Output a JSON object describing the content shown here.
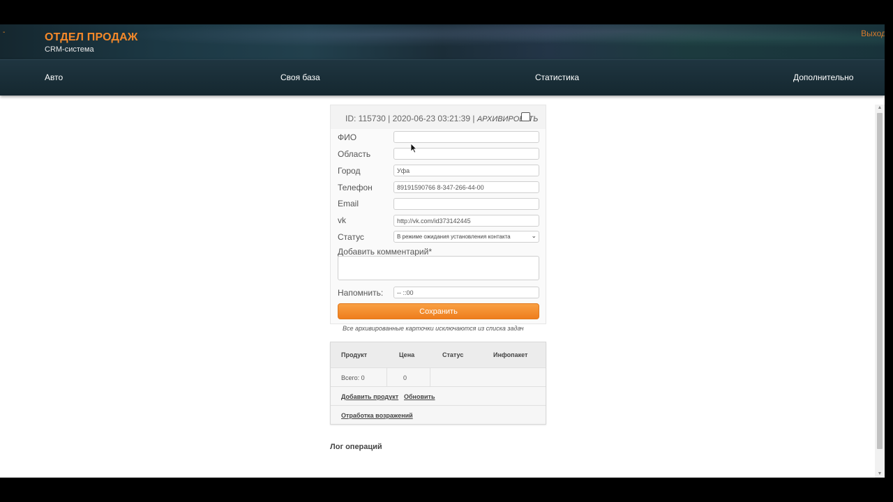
{
  "header": {
    "corner_mark": "-",
    "title": "ОТДЕЛ ПРОДАЖ",
    "subtitle": "CRM-система",
    "logout_label": "Выход"
  },
  "nav": {
    "items": [
      {
        "label": "Авто"
      },
      {
        "label": "Своя база"
      },
      {
        "label": "Статистика"
      },
      {
        "label": "Дополнительно"
      }
    ]
  },
  "card": {
    "meta": "ID: 115730 | 2020-06-23 03:21:39 |",
    "archive_label": "АРХИВИРОВАТЬ",
    "archive_checked": false,
    "fields": {
      "fio": {
        "label": "ФИО",
        "value": ""
      },
      "region": {
        "label": "Область",
        "value": ""
      },
      "city": {
        "label": "Город",
        "value": "Уфа"
      },
      "phone": {
        "label": "Телефон",
        "value": "89191590766 8-347-266-44-00"
      },
      "email": {
        "label": "Email",
        "value": ""
      },
      "vk": {
        "label": "vk",
        "value": "http://vk.com/id373142445"
      },
      "status": {
        "label": "Статус",
        "value": "В режиме ожидания установления контакта"
      },
      "comment": {
        "label": "Добавить комментарий*",
        "value": ""
      },
      "remind": {
        "label": "Напомнить:",
        "value": "-- ::00"
      }
    },
    "save_label": "Сохранить",
    "note": "Все архивированные карточки исключаются из списка задач"
  },
  "products": {
    "headers": [
      "Продукт",
      "Цена",
      "Статус",
      "Инфопакет"
    ],
    "total_label": "Всего: 0",
    "total_price": "0",
    "add_link": "Добавить продукт",
    "refresh_link": "Обновить",
    "objections_link": "Отработка возражений"
  },
  "log": {
    "title": "Лог операций"
  },
  "colors": {
    "accent": "#f5892a",
    "button": "#ee7d1d",
    "header_bg": "#1c3844"
  }
}
